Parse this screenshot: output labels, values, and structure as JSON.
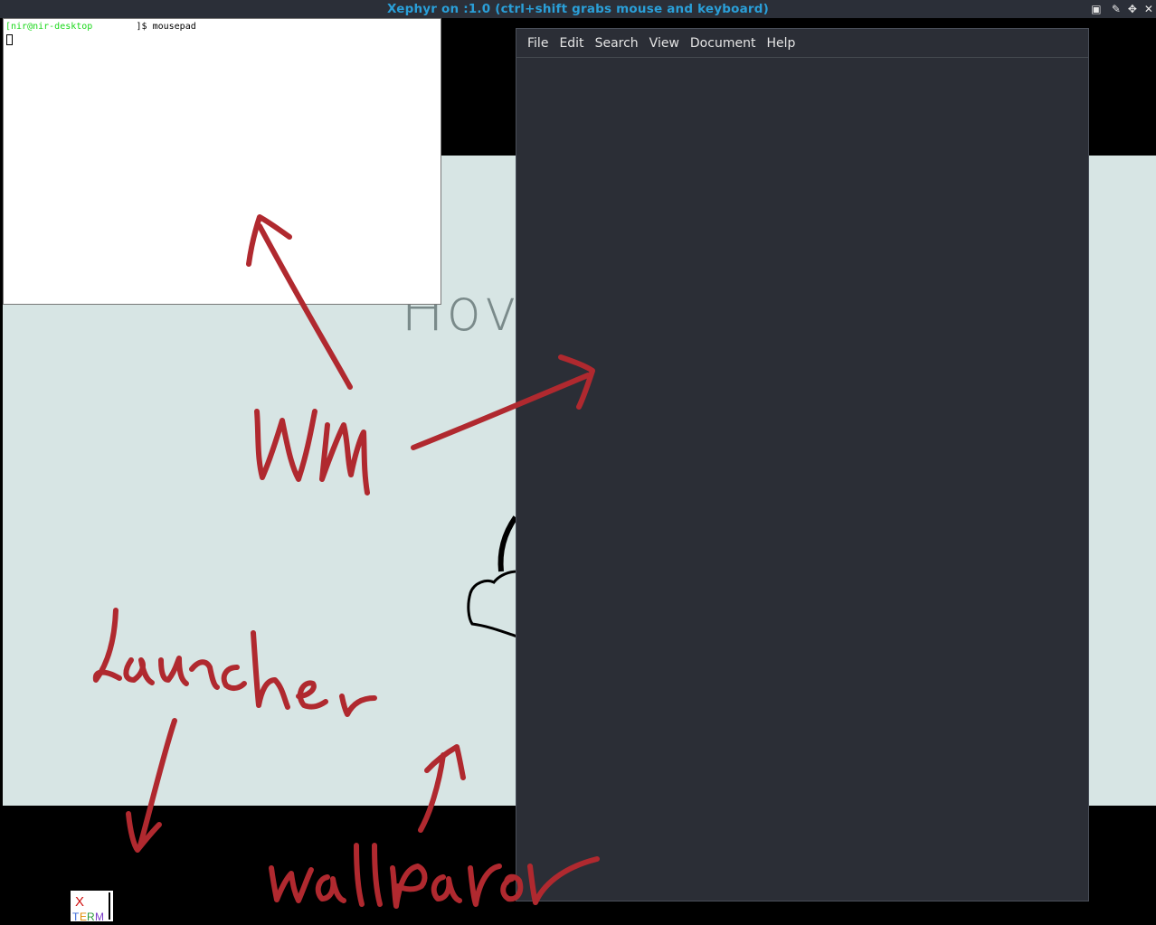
{
  "window": {
    "title": "Xephyr on :1.0 (ctrl+shift grabs mouse and keyboard)"
  },
  "wallpaper": {
    "visible_text": "Hov"
  },
  "terminal": {
    "prompt_user": "[nir@nir-desktop",
    "prompt_end": "]$",
    "command": "mousepad"
  },
  "mousepad": {
    "menu": [
      "File",
      "Edit",
      "Search",
      "View",
      "Document",
      "Help"
    ]
  },
  "launcher": {
    "icon": "xterm-icon",
    "icon_text_top": "X",
    "icon_text_bottom": "TERM"
  },
  "annotations": {
    "note": "handwritten labels drawn as picture",
    "labels": [
      "WM",
      "Launcher",
      "wallpaper"
    ],
    "color": "#b0292f"
  },
  "colors": {
    "titlebar_bg": "#2b2f38",
    "title_text": "#2a9fd8",
    "wallpaper_bg": "#d7e5e4",
    "mousepad_bg": "#2b2e36",
    "prompt_green": "#1bd81b"
  }
}
